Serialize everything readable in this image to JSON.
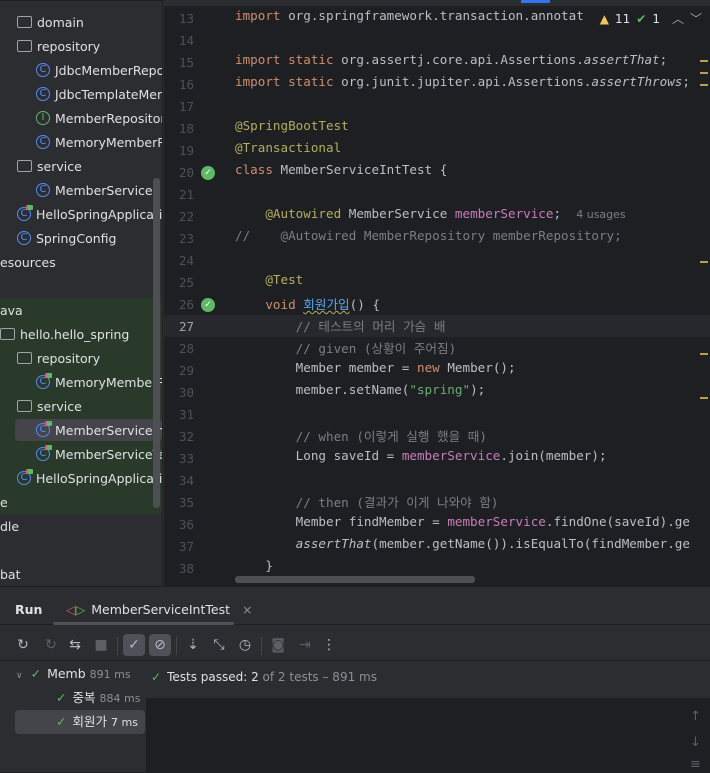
{
  "project_tree": [
    {
      "label": "domain",
      "icon": "folder",
      "indent": 17,
      "chev": true
    },
    {
      "label": "repository",
      "icon": "folder",
      "indent": 17,
      "chev": true
    },
    {
      "label": "JdbcMemberRepository",
      "icon": "class",
      "indent": 36
    },
    {
      "label": "JdbcTemplateMemberRepository",
      "icon": "class",
      "indent": 36
    },
    {
      "label": "MemberRepository",
      "icon": "interface",
      "indent": 36
    },
    {
      "label": "MemoryMemberRepository",
      "icon": "class",
      "indent": 36
    },
    {
      "label": "service",
      "icon": "folder",
      "indent": 17,
      "chev": true
    },
    {
      "label": "MemberService",
      "icon": "class",
      "indent": 36
    },
    {
      "label": "HelloSpringApplication",
      "icon": "spring-class",
      "indent": 17
    },
    {
      "label": "SpringConfig",
      "icon": "class",
      "indent": 17
    },
    {
      "label": "esources",
      "icon": "none",
      "indent": 0
    },
    {
      "label": "",
      "icon": "none",
      "indent": 0
    },
    {
      "label": "ava",
      "icon": "none",
      "indent": 0
    },
    {
      "label": "hello.hello_spring",
      "icon": "package",
      "indent": 0
    },
    {
      "label": "repository",
      "icon": "folder",
      "indent": 17,
      "chev": true
    },
    {
      "label": "MemoryMemberRepositoryTest",
      "icon": "test",
      "indent": 36
    },
    {
      "label": "service",
      "icon": "folder",
      "indent": 17,
      "chev": true
    },
    {
      "label": "MemberServiceIntTest",
      "icon": "test",
      "indent": 36,
      "selected": true
    },
    {
      "label": "MemberServiceTest",
      "icon": "test",
      "indent": 36
    },
    {
      "label": "HelloSpringApplicationTests",
      "icon": "test",
      "indent": 17
    },
    {
      "label": "e",
      "icon": "none",
      "indent": 0
    },
    {
      "label": "dle",
      "icon": "none",
      "indent": 0
    },
    {
      "label": "",
      "icon": "none",
      "indent": 0
    },
    {
      "label": "bat",
      "icon": "none",
      "indent": 0
    }
  ],
  "inspections": {
    "warnings": "11",
    "passed": "1"
  },
  "editor": {
    "current_line": 27,
    "usages_hint": "4 usages",
    "lines": [
      {
        "n": 13,
        "t": [
          [
            "kw",
            "import "
          ],
          [
            "",
            "org.springframework.transaction.annotat"
          ]
        ]
      },
      {
        "n": 14,
        "t": []
      },
      {
        "n": 15,
        "t": [
          [
            "kw",
            "import static "
          ],
          [
            "",
            "org.assertj.core.api.Assertions."
          ],
          [
            "it",
            "assertThat"
          ],
          [
            "",
            ";"
          ]
        ]
      },
      {
        "n": 16,
        "t": [
          [
            "kw",
            "import static "
          ],
          [
            "",
            "org.junit.jupiter.api.Assertions."
          ],
          [
            "it",
            "assertThrows"
          ],
          [
            "",
            ";"
          ]
        ]
      },
      {
        "n": 17,
        "t": []
      },
      {
        "n": 18,
        "t": [
          [
            "an",
            "@SpringBootTest"
          ]
        ]
      },
      {
        "n": 19,
        "t": [
          [
            "an",
            "@Transactional"
          ]
        ]
      },
      {
        "n": 20,
        "t": [
          [
            "kw",
            "class "
          ],
          [
            "",
            "MemberServiceIntTest {"
          ]
        ],
        "gutter": "run-test"
      },
      {
        "n": 21,
        "t": []
      },
      {
        "n": 22,
        "t": [
          [
            "",
            "    "
          ],
          [
            "an",
            "@Autowired "
          ],
          [
            "",
            "MemberService "
          ],
          [
            "fld",
            "memberService"
          ],
          [
            "",
            ";  "
          ],
          [
            "hint",
            "4 usages"
          ]
        ]
      },
      {
        "n": 23,
        "t": [
          [
            "cm",
            "//    @Autowired MemberRepository memberRepository;"
          ]
        ]
      },
      {
        "n": 24,
        "t": []
      },
      {
        "n": 25,
        "t": [
          [
            "",
            "    "
          ],
          [
            "an",
            "@Test"
          ]
        ]
      },
      {
        "n": 26,
        "t": [
          [
            "",
            "    "
          ],
          [
            "kw",
            "void "
          ],
          [
            "fn",
            "회원가입"
          ],
          [
            "",
            "() {"
          ]
        ],
        "gutter": "run-test"
      },
      {
        "n": 27,
        "t": [
          [
            "cm",
            "        // 테스트의 머리 가슴 배"
          ]
        ]
      },
      {
        "n": 28,
        "t": [
          [
            "cm",
            "        // given (상황이 주어짐)"
          ]
        ]
      },
      {
        "n": 29,
        "t": [
          [
            "",
            "        Member member = "
          ],
          [
            "kw",
            "new "
          ],
          [
            "",
            "Member();"
          ]
        ]
      },
      {
        "n": 30,
        "t": [
          [
            "",
            "        member.setName("
          ],
          [
            "str",
            "\"spring\""
          ],
          [
            "",
            ");"
          ]
        ]
      },
      {
        "n": 31,
        "t": []
      },
      {
        "n": 32,
        "t": [
          [
            "cm",
            "        // when (이렇게 실행 했을 때)"
          ]
        ]
      },
      {
        "n": 33,
        "t": [
          [
            "",
            "        Long saveId = "
          ],
          [
            "fld",
            "memberService"
          ],
          [
            "",
            ".join(member);"
          ]
        ]
      },
      {
        "n": 34,
        "t": []
      },
      {
        "n": 35,
        "t": [
          [
            "cm",
            "        // then (결과가 이게 나와야 함)"
          ]
        ]
      },
      {
        "n": 36,
        "t": [
          [
            "",
            "        Member findMember = "
          ],
          [
            "fld",
            "memberService"
          ],
          [
            "",
            ".findOne(saveId).ge"
          ]
        ]
      },
      {
        "n": 37,
        "t": [
          [
            "",
            "        "
          ],
          [
            "it",
            "assertThat"
          ],
          [
            "",
            "(member.getName()).isEqualTo(findMember.ge"
          ]
        ]
      },
      {
        "n": 38,
        "t": [
          [
            "",
            "    }"
          ]
        ]
      }
    ]
  },
  "run": {
    "title": "Run",
    "tab_label": "MemberServiceIntTest",
    "toolbar": [
      "rerun",
      "rerun-failed",
      "toggle-auto-test",
      "stop",
      "show-passed",
      "show-ignored",
      "sort",
      "collapse",
      "history",
      "screenshot",
      "export",
      "more"
    ],
    "tree": [
      {
        "label": "Memb",
        "time": "891 ms",
        "level": 0
      },
      {
        "label": "중복",
        "time": "884 ms",
        "level": 1
      },
      {
        "label": "회원가",
        "time": "7 ms",
        "level": 1,
        "selected": true
      }
    ],
    "status": {
      "passed_label": "Tests passed: ",
      "passed": "2",
      "rest": " of 2 tests – 891 ms"
    }
  }
}
